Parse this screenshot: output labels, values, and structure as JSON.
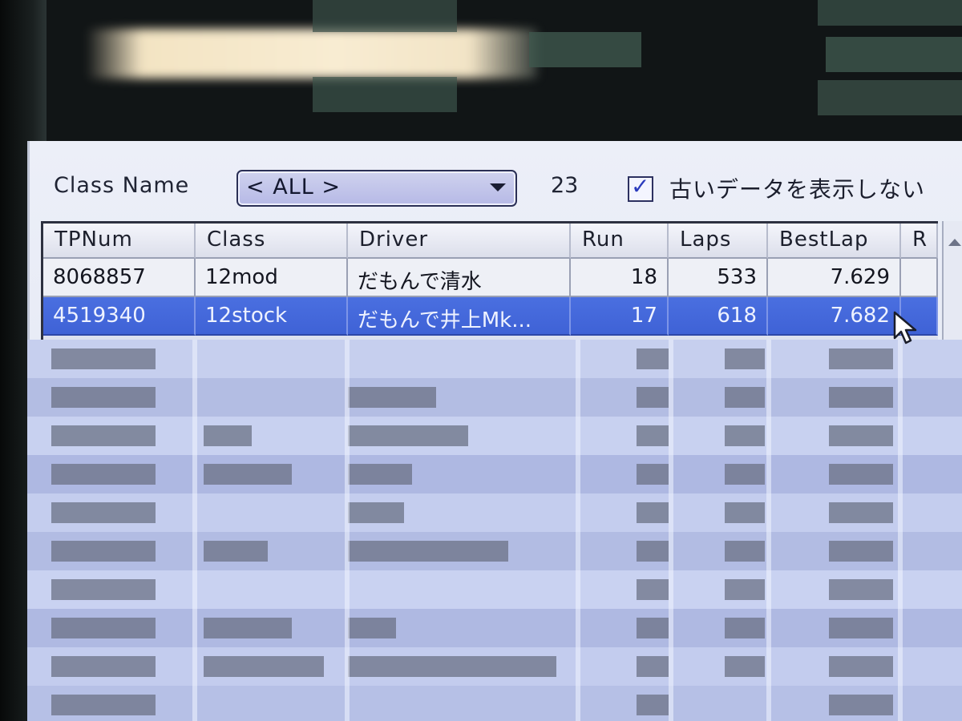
{
  "toolbar": {
    "class_label": "Class Name",
    "class_selected": "< ALL >",
    "count": "23",
    "hide_old_checked": true,
    "hide_old_label": "古いデータを表示しない"
  },
  "table": {
    "columns": [
      "TPNum",
      "Class",
      "Driver",
      "Run",
      "Laps",
      "BestLap",
      "R"
    ],
    "rows": [
      {
        "tpnum": "8068857",
        "class": "12mod",
        "driver": "だもんで清水",
        "run": "18",
        "laps": "533",
        "bestlap": "7.629",
        "r": ""
      },
      {
        "tpnum": "4519340",
        "class": "12stock",
        "driver": "だもんで井上Mk...",
        "run": "17",
        "laps": "618",
        "bestlap": "7.682",
        "r": ""
      }
    ],
    "selected_row": 1
  },
  "colors": {
    "selection": "#3f62d6",
    "window_bg": "#e6e9f3",
    "blurred_bg": "#bcc6e6"
  }
}
